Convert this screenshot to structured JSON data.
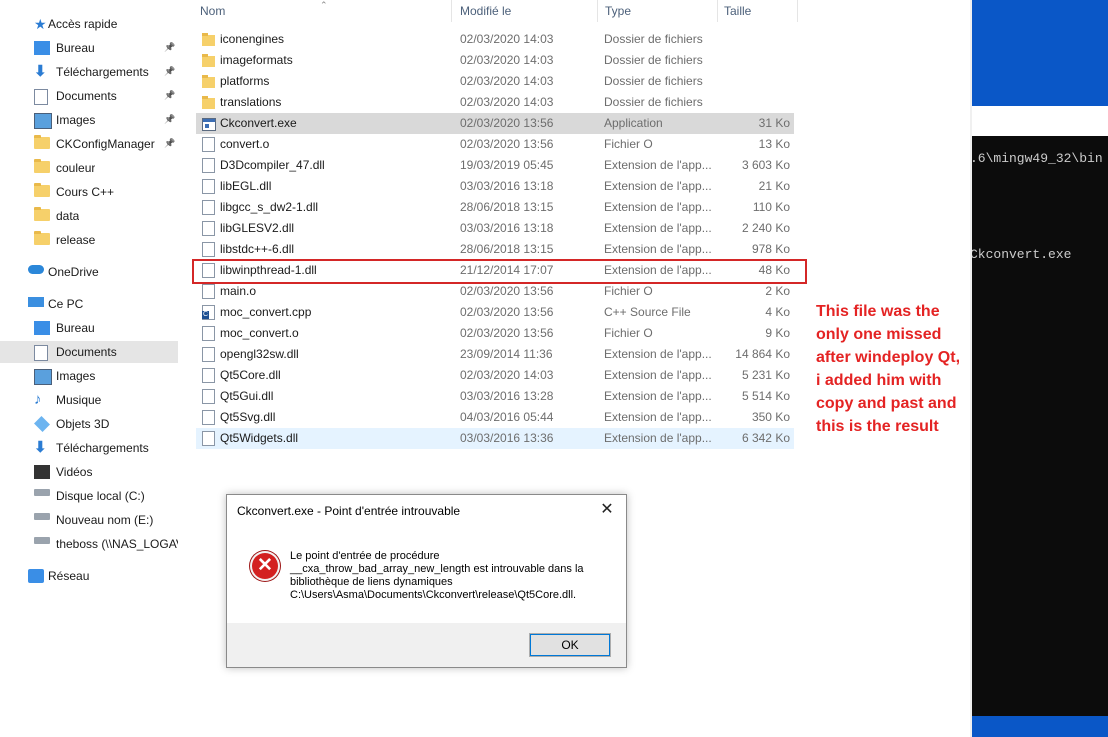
{
  "nav": {
    "items": [
      {
        "label": "Accès rapide",
        "icon": "star-icon"
      },
      {
        "label": "Bureau",
        "icon": "desktop-icon",
        "pinned": true
      },
      {
        "label": "Téléchargements",
        "icon": "download-icon",
        "pinned": true
      },
      {
        "label": "Documents",
        "icon": "documents-icon",
        "pinned": true
      },
      {
        "label": "Images",
        "icon": "pictures-icon",
        "pinned": true
      },
      {
        "label": "CKConfigManager",
        "icon": "folder-icon",
        "pinned": true
      },
      {
        "label": "couleur",
        "icon": "folder-icon"
      },
      {
        "label": "Cours C++",
        "icon": "folder-icon"
      },
      {
        "label": "data",
        "icon": "folder-icon"
      },
      {
        "label": "release",
        "icon": "folder-icon"
      },
      {
        "label": "OneDrive",
        "icon": "onedrive-icon"
      },
      {
        "label": "Ce PC",
        "icon": "computer-icon"
      },
      {
        "label": "Bureau",
        "icon": "desktop-icon"
      },
      {
        "label": "Documents",
        "icon": "documents-icon"
      },
      {
        "label": "Images",
        "icon": "pictures-icon"
      },
      {
        "label": "Musique",
        "icon": "music-icon"
      },
      {
        "label": "Objets 3D",
        "icon": "3d-objects-icon"
      },
      {
        "label": "Téléchargements",
        "icon": "download-icon"
      },
      {
        "label": "Vidéos",
        "icon": "videos-icon"
      },
      {
        "label": "Disque local (C:)",
        "icon": "drive-icon"
      },
      {
        "label": "Nouveau nom (E:)",
        "icon": "drive-icon"
      },
      {
        "label": "theboss (\\\\NAS_LOGAV",
        "icon": "network-drive-icon"
      },
      {
        "label": "Réseau",
        "icon": "network-icon"
      }
    ]
  },
  "columns": {
    "name": "Nom",
    "modified": "Modifié le",
    "type": "Type",
    "size": "Taille"
  },
  "files": [
    {
      "name": "iconengines",
      "date": "02/03/2020 14:03",
      "type": "Dossier de fichiers",
      "size": "",
      "kind": "folder"
    },
    {
      "name": "imageformats",
      "date": "02/03/2020 14:03",
      "type": "Dossier de fichiers",
      "size": "",
      "kind": "folder"
    },
    {
      "name": "platforms",
      "date": "02/03/2020 14:03",
      "type": "Dossier de fichiers",
      "size": "",
      "kind": "folder"
    },
    {
      "name": "translations",
      "date": "02/03/2020 14:03",
      "type": "Dossier de fichiers",
      "size": "",
      "kind": "folder"
    },
    {
      "name": "Ckconvert.exe",
      "date": "02/03/2020 13:56",
      "type": "Application",
      "size": "31 Ko",
      "kind": "app"
    },
    {
      "name": "convert.o",
      "date": "02/03/2020 13:56",
      "type": "Fichier O",
      "size": "13 Ko",
      "kind": "file"
    },
    {
      "name": "D3Dcompiler_47.dll",
      "date": "19/03/2019 05:45",
      "type": "Extension de l'app...",
      "size": "3 603 Ko",
      "kind": "file"
    },
    {
      "name": "libEGL.dll",
      "date": "03/03/2016 13:18",
      "type": "Extension de l'app...",
      "size": "21 Ko",
      "kind": "file"
    },
    {
      "name": "libgcc_s_dw2-1.dll",
      "date": "28/06/2018 13:15",
      "type": "Extension de l'app...",
      "size": "110 Ko",
      "kind": "file"
    },
    {
      "name": "libGLESV2.dll",
      "date": "03/03/2016 13:18",
      "type": "Extension de l'app...",
      "size": "2 240 Ko",
      "kind": "file"
    },
    {
      "name": "libstdc++-6.dll",
      "date": "28/06/2018 13:15",
      "type": "Extension de l'app...",
      "size": "978 Ko",
      "kind": "file"
    },
    {
      "name": "libwinpthread-1.dll",
      "date": "21/12/2014 17:07",
      "type": "Extension de l'app...",
      "size": "48 Ko",
      "kind": "file"
    },
    {
      "name": "main.o",
      "date": "02/03/2020 13:56",
      "type": "Fichier O",
      "size": "2 Ko",
      "kind": "file"
    },
    {
      "name": "moc_convert.cpp",
      "date": "02/03/2020 13:56",
      "type": "C++ Source File",
      "size": "4 Ko",
      "kind": "cpp"
    },
    {
      "name": "moc_convert.o",
      "date": "02/03/2020 13:56",
      "type": "Fichier O",
      "size": "9 Ko",
      "kind": "file"
    },
    {
      "name": "opengl32sw.dll",
      "date": "23/09/2014 11:36",
      "type": "Extension de l'app...",
      "size": "14 864 Ko",
      "kind": "file"
    },
    {
      "name": "Qt5Core.dll",
      "date": "02/03/2020 14:03",
      "type": "Extension de l'app...",
      "size": "5 231 Ko",
      "kind": "file"
    },
    {
      "name": "Qt5Gui.dll",
      "date": "03/03/2016 13:28",
      "type": "Extension de l'app...",
      "size": "5 514 Ko",
      "kind": "file"
    },
    {
      "name": "Qt5Svg.dll",
      "date": "04/03/2016 05:44",
      "type": "Extension de l'app...",
      "size": "350 Ko",
      "kind": "file"
    },
    {
      "name": "Qt5Widgets.dll",
      "date": "03/03/2016 13:36",
      "type": "Extension de l'app...",
      "size": "6 342 Ko",
      "kind": "file"
    }
  ],
  "annotation": "This file was the only one missed after windeploy Qt, i added him with copy and past and this is the result",
  "console": {
    "line1": ".6\\mingw49_32\\bin",
    "line2": "Ckconvert.exe"
  },
  "dialog": {
    "title": "Ckconvert.exe - Point d'entrée introuvable",
    "close": "✕",
    "icon_glyph": "✕",
    "message_lines": [
      "Le point d'entrée de procédure",
      "__cxa_throw_bad_array_new_length est introuvable dans la",
      "bibliothèque de liens dynamiques",
      "C:\\Users\\Asma\\Documents\\Ckconvert\\release\\Qt5Core.dll."
    ],
    "ok_label": "OK"
  },
  "colors": {
    "highlight": "#d42727",
    "annotation": "#e42323",
    "error_icon": "#d32020",
    "desktop_blue": "#0a57c7"
  }
}
